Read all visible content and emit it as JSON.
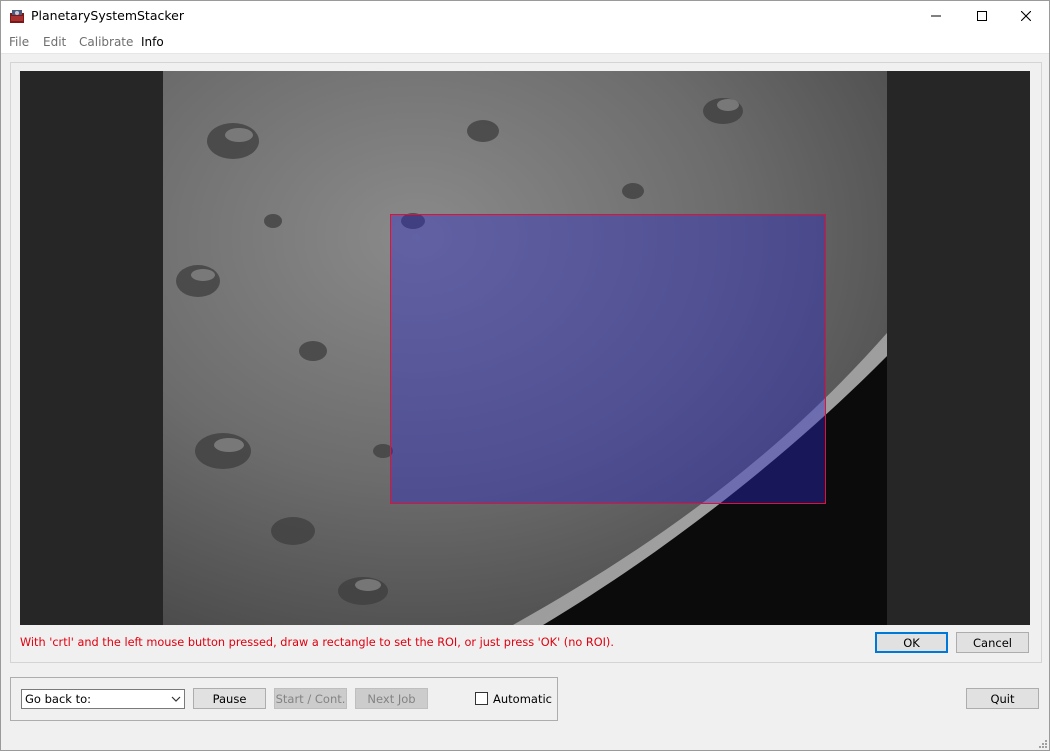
{
  "window": {
    "title": "PlanetarySystemStacker"
  },
  "menu": [
    {
      "label": "File",
      "enabled": false
    },
    {
      "label": "Edit",
      "enabled": false
    },
    {
      "label": "Calibrate",
      "enabled": false
    },
    {
      "label": "Info",
      "enabled": true
    }
  ],
  "roi": {
    "instruction": "With 'crtl' and the left mouse button pressed, draw a rectangle to set the ROI, or just press 'OK' (no ROI).",
    "ok_label": "OK",
    "cancel_label": "Cancel",
    "selection_color": "#e8102c",
    "overlay_color": "#2828c8"
  },
  "controls": {
    "goto_label": "Go back to:",
    "pause_label": "Pause",
    "start_label": "Start / Cont.",
    "next_job_label": "Next Job",
    "automatic_label": "Automatic",
    "automatic_checked": false,
    "quit_label": "Quit"
  }
}
